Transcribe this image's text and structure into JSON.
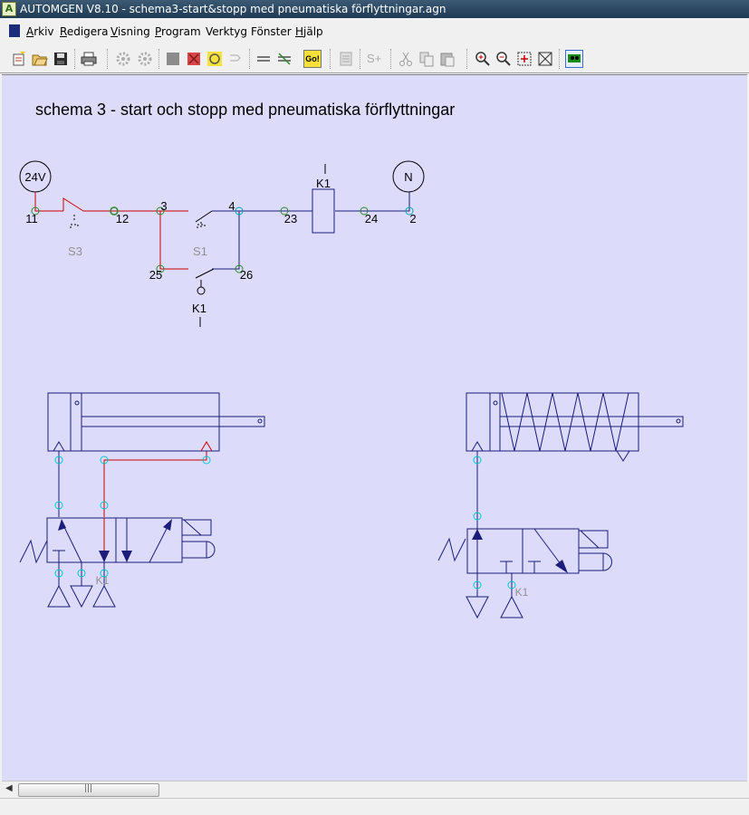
{
  "window": {
    "title": "AUTOMGEN V8.10 - schema3-start&stopp med pneumatiska förflyttningar.agn"
  },
  "menu": [
    {
      "accel": "A",
      "rest": "rkiv"
    },
    {
      "accel": "R",
      "rest": "edigera"
    },
    {
      "accel": "V",
      "rest": "isning"
    },
    {
      "accel": "P",
      "rest": "rogram"
    },
    {
      "accel": "",
      "rest": "Verktyg"
    },
    {
      "accel": "",
      "rest": "Fönster"
    },
    {
      "accel": "H",
      "rest": "jälp"
    }
  ],
  "toolbar_icons": [
    "new-icon",
    "open-icon",
    "save-icon",
    "print-icon",
    "gears-icon",
    "gears2-icon",
    "stop-icon",
    "red-x-icon",
    "cycle-icon",
    "step-icon",
    "run-icon",
    "flow-icon",
    "go-icon",
    "list-icon",
    "s-plus-icon",
    "cut-icon",
    "copy-icon",
    "paste-icon",
    "zoom-in-icon",
    "zoom-out-icon",
    "fit-icon",
    "full-icon",
    "monitor-icon"
  ],
  "go_label": "Go!",
  "s_plus_label": "S+",
  "schema": {
    "heading": "schema 3 - start och stopp med pneumatiska förflyttningar",
    "supply_label": "24V",
    "neutral_label": "N",
    "node_labels": {
      "n11": "11",
      "n12": "12",
      "n3": "3",
      "n4": "4",
      "n23": "23",
      "n24": "24",
      "n2": "2",
      "n25": "25",
      "n26": "26"
    },
    "switch_s3": "S3",
    "switch_s1": "S1",
    "coil_k1": "K1",
    "contact_k1": "K1",
    "valve_left_label": "K1",
    "valve_right_label": "K1"
  },
  "colors": {
    "wire_red": "#cc0000",
    "wire_blue": "#1c1c7a",
    "node_cyan": "#00c8d8",
    "node_green": "#2a8a2a",
    "canvas": "#dcdcfa"
  }
}
